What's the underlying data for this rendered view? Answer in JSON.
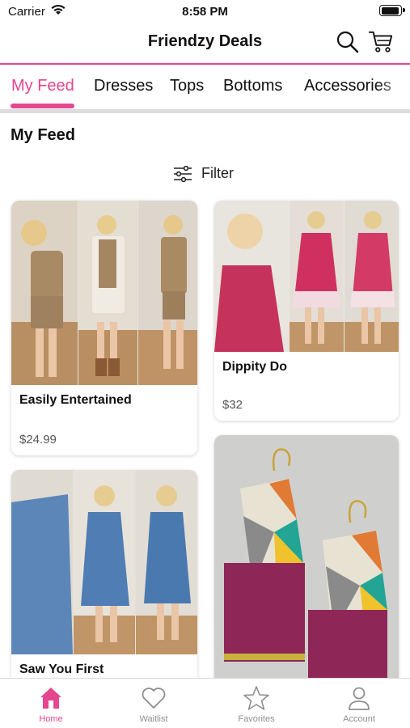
{
  "status_bar": {
    "carrier": "Carrier",
    "time": "8:58 PM"
  },
  "header": {
    "title": "Friendzy Deals",
    "search_icon": "search-icon",
    "cart_icon": "cart-icon"
  },
  "tabs": [
    {
      "label": "My Feed",
      "active": true
    },
    {
      "label": "Dresses",
      "active": false
    },
    {
      "label": "Tops",
      "active": false
    },
    {
      "label": "Bottoms",
      "active": false
    },
    {
      "label": "Accessories",
      "active": false
    }
  ],
  "feed": {
    "title": "My Feed",
    "filter_label": "Filter",
    "products": [
      {
        "name": "Easily Entertained",
        "price": "$24.99"
      },
      {
        "name": "Dippity Do",
        "price": "$32"
      },
      {
        "name": "Saw You First",
        "price": ""
      },
      {
        "name": "",
        "price": ""
      }
    ]
  },
  "tab_bar": [
    {
      "label": "Home",
      "icon": "home-icon",
      "active": true
    },
    {
      "label": "Waitlist",
      "icon": "heart-icon",
      "active": false
    },
    {
      "label": "Favorites",
      "icon": "star-icon",
      "active": false
    },
    {
      "label": "Account",
      "icon": "account-icon",
      "active": false
    }
  ],
  "colors": {
    "accent": "#e5468f",
    "divider": "#dcdcdc",
    "inactive_icon": "#8f8f8f"
  }
}
